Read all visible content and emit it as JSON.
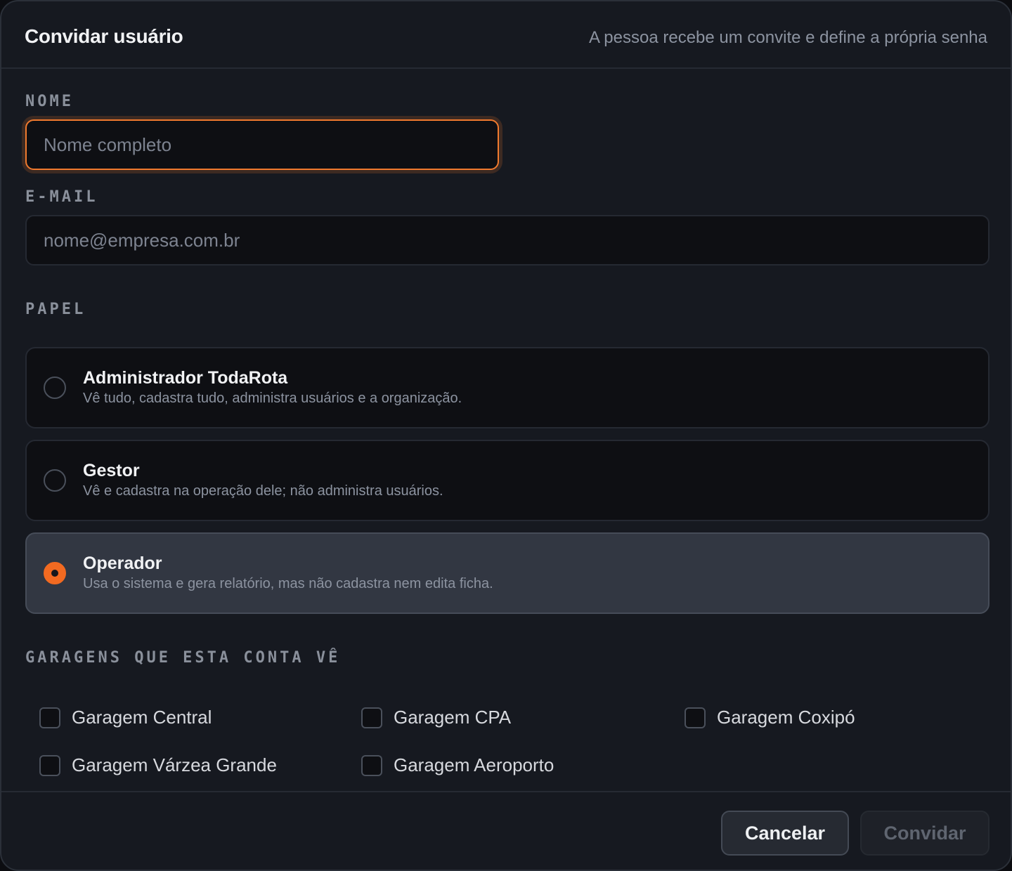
{
  "header": {
    "title": "Convidar usuário",
    "subtitle": "A pessoa recebe um convite e define a própria senha"
  },
  "form": {
    "name": {
      "label": "NOME",
      "value": "",
      "placeholder": "Nome completo"
    },
    "email": {
      "label": "E-MAIL",
      "value": "",
      "placeholder": "nome@empresa.com.br"
    },
    "role": {
      "label": "PAPEL",
      "selected": "Operador",
      "options": [
        {
          "title": "Administrador TodaRota",
          "description": "Vê tudo, cadastra tudo, administra usuários e a organização."
        },
        {
          "title": "Gestor",
          "description": "Vê e cadastra na operação dele; não administra usuários."
        },
        {
          "title": "Operador",
          "description": "Usa o sistema e gera relatório, mas não cadastra nem edita ficha."
        }
      ]
    },
    "garages": {
      "label": "GARAGENS QUE ESTA CONTA VÊ",
      "items": [
        {
          "label": "Garagem Central",
          "checked": false
        },
        {
          "label": "Garagem CPA",
          "checked": false
        },
        {
          "label": "Garagem Coxipó",
          "checked": false
        },
        {
          "label": "Garagem Várzea Grande",
          "checked": false
        },
        {
          "label": "Garagem Aeroporto",
          "checked": false
        }
      ]
    }
  },
  "footer": {
    "cancel_label": "Cancelar",
    "invite_label": "Convidar"
  },
  "colors": {
    "accent": "#f26a21",
    "background": "#161920",
    "input_background": "#0e0f13",
    "selected_option": "#323742"
  }
}
